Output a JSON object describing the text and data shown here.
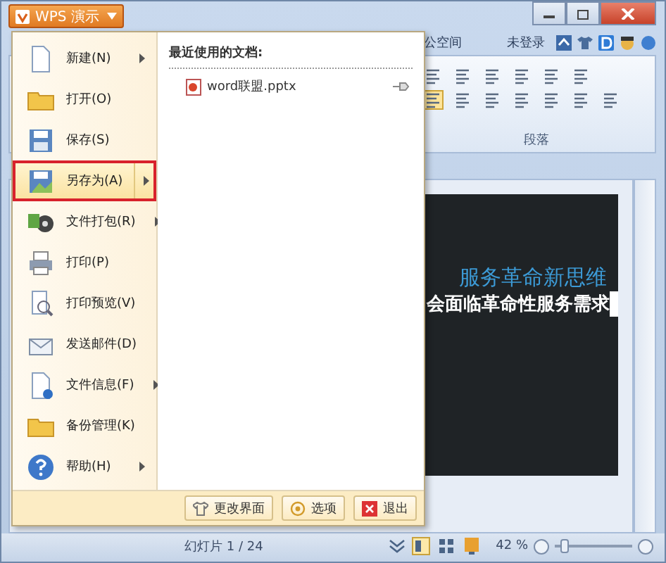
{
  "app_button": {
    "label": "WPS 演示"
  },
  "title_bar": {
    "partial_tab": "公空间",
    "login": "未登录"
  },
  "ribbon": {
    "group_label": "段落"
  },
  "slide": {
    "lines": [
      "服务革命新思维",
      "会面临革命性服务需求"
    ]
  },
  "status_bar": {
    "slide_counter": "幻灯片 1 / 24",
    "zoom": "42 %",
    "zoom_slider": {
      "level": 0.12
    }
  },
  "menu": {
    "items": [
      {
        "label": "新建(N)",
        "submenu": true,
        "selected": false
      },
      {
        "label": "打开(O)",
        "submenu": false,
        "selected": false
      },
      {
        "label": "保存(S)",
        "submenu": false,
        "selected": false
      },
      {
        "label": "另存为(A)",
        "submenu": true,
        "selected": true
      },
      {
        "label": "文件打包(R)",
        "submenu": true,
        "selected": false
      },
      {
        "label": "打印(P)",
        "submenu": false,
        "selected": false
      },
      {
        "label": "打印预览(V)",
        "submenu": false,
        "selected": false
      },
      {
        "label": "发送邮件(D)",
        "submenu": false,
        "selected": false
      },
      {
        "label": "文件信息(F)",
        "submenu": true,
        "selected": false
      },
      {
        "label": "备份管理(K)",
        "submenu": false,
        "selected": false
      },
      {
        "label": "帮助(H)",
        "submenu": true,
        "selected": false
      }
    ],
    "recent_title": "最近使用的文档:",
    "recent_files": [
      {
        "name": "word联盟.pptx"
      }
    ],
    "footer_buttons": [
      {
        "label": "更改界面"
      },
      {
        "label": "选项"
      },
      {
        "label": "退出"
      }
    ]
  }
}
